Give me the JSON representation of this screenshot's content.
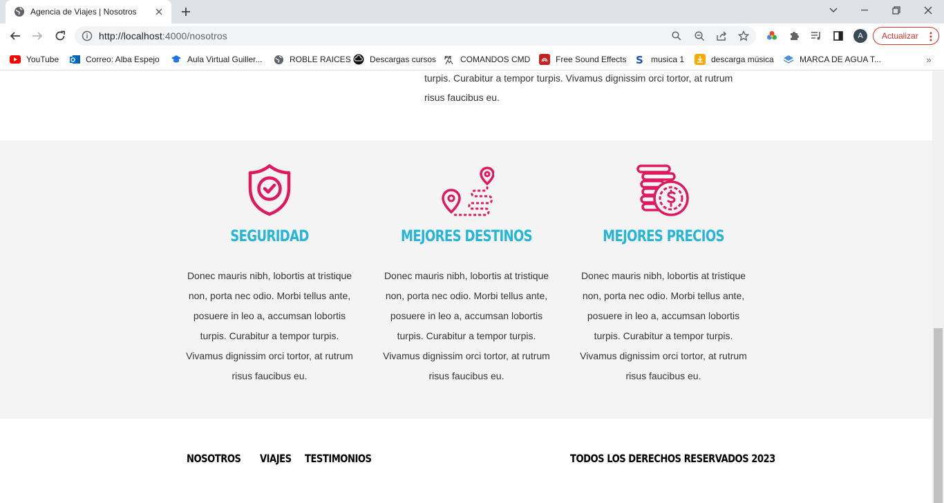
{
  "browser": {
    "tab_title": "Agencia de Viajes | Nosotros",
    "url_host": "http://localhost",
    "url_rest": ":4000/nosotros",
    "avatar_letter": "A",
    "update_label": "Actualizar",
    "accent": "#d93025"
  },
  "bookmarks": [
    {
      "label": "YouTube",
      "icon": "youtube-icon"
    },
    {
      "label": "Correo: Alba Espejo",
      "icon": "outlook-icon"
    },
    {
      "label": "Aula Virtual Guiller...",
      "icon": "graduation-cap-icon"
    },
    {
      "label": "ROBLE RAICES",
      "icon": "globe-icon"
    },
    {
      "label": "Descargas cursos",
      "icon": "download-cloud-icon"
    },
    {
      "label": "COMANDOS CMD",
      "icon": "pr-icon"
    },
    {
      "label": "Free Sound Effects",
      "icon": "sound-icon"
    },
    {
      "label": "musica 1",
      "icon": "s-icon"
    },
    {
      "label": "descarga música",
      "icon": "download-box-icon"
    },
    {
      "label": "MARCA DE AGUA T...",
      "icon": "layers-icon"
    }
  ],
  "page": {
    "top_text": "turpis. Curabitur a tempor turpis. Vivamus dignissim orci tortor, at rutrum risus faucibus eu.",
    "features": [
      {
        "title": "Seguridad",
        "icon": "shield-check-icon",
        "text": "Donec mauris nibh, lobortis at tristique non, porta nec odio. Morbi tellus ante, posuere in leo a, accumsan lobortis turpis. Curabitur a tempor turpis. Vivamus dignissim orci tortor, at rutrum risus faucibus eu."
      },
      {
        "title": "Mejores Destinos",
        "icon": "route-pins-icon",
        "text": "Donec mauris nibh, lobortis at tristique non, porta nec odio. Morbi tellus ante, posuere in leo a, accumsan lobortis turpis. Curabitur a tempor turpis. Vivamus dignissim orci tortor, at rutrum risus faucibus eu."
      },
      {
        "title": "Mejores Precios",
        "icon": "coins-dollar-icon",
        "text": "Donec mauris nibh, lobortis at tristique non, porta nec odio. Morbi tellus ante, posuere in leo a, accumsan lobortis turpis. Curabitur a tempor turpis. Vivamus dignissim orci tortor, at rutrum risus faucibus eu."
      }
    ],
    "colors": {
      "icon": "#e0195f",
      "heading": "#25b5d6",
      "band": "#f4f4f4"
    }
  },
  "footer": {
    "nav": [
      "Nosotros",
      "Viajes",
      "Testimonios"
    ],
    "copyright": "Todos los derechos reservados 2023"
  }
}
